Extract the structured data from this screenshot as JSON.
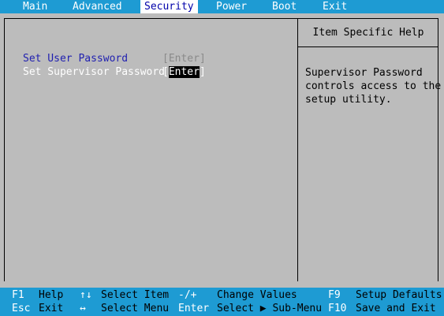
{
  "menu": {
    "tabs": [
      {
        "label": "Main"
      },
      {
        "label": "Advanced"
      },
      {
        "label": "Security"
      },
      {
        "label": "Power"
      },
      {
        "label": "Boot"
      },
      {
        "label": "Exit"
      }
    ],
    "active_tab": "Security"
  },
  "settings": [
    {
      "label": "Set User Password",
      "value_open": "[",
      "value_text": "Enter",
      "value_close": "]"
    },
    {
      "label": "Set Supervisor Password",
      "value_open": "[",
      "value_text": "Enter",
      "value_close": "]"
    }
  ],
  "help": {
    "title": "Item Specific Help",
    "lines": [
      "Supervisor Password",
      "controls access to the",
      "setup utility."
    ]
  },
  "keys": {
    "row1": [
      {
        "key": "F1",
        "desc": "Help"
      },
      {
        "key": "↑↓",
        "desc": "Select Item"
      },
      {
        "key": "-/+",
        "desc": "Change Values"
      },
      {
        "key": "F9",
        "desc": "Setup Defaults"
      }
    ],
    "row2": [
      {
        "key": "Esc",
        "desc": "Exit"
      },
      {
        "key": "↔",
        "desc": "Select Menu"
      },
      {
        "key": "Enter",
        "desc": "Select ▶ Sub-Menu"
      },
      {
        "key": "F10",
        "desc": "Save and Exit"
      }
    ]
  },
  "colors": {
    "bar_background": "#1e9bd3",
    "panel_background": "#bcbcbc",
    "active_tab_text": "#0000aa",
    "highlight_label": "#ffffff",
    "normal_label": "#1f1fb0"
  }
}
